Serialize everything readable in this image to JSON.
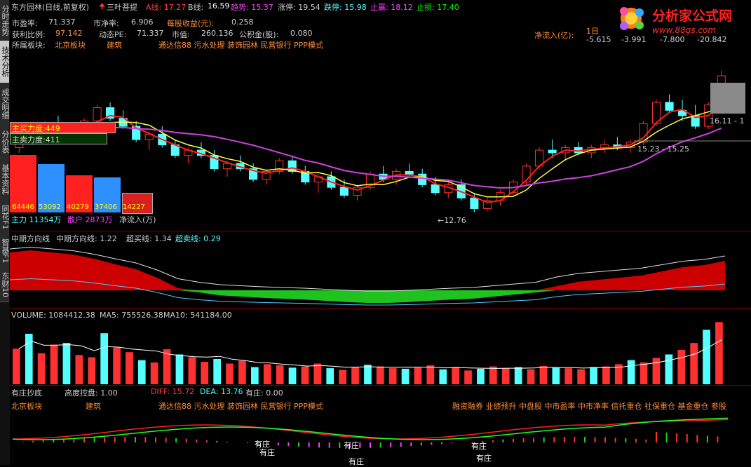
{
  "side_tabs": [
    {
      "label": "分时走势",
      "active": false
    },
    {
      "label": "技术分析",
      "active": true
    },
    {
      "label": "成交明细",
      "active": false
    },
    {
      "label": "分价表",
      "active": false
    },
    {
      "label": "基本资料",
      "active": false
    },
    {
      "label": "同花F1",
      "active": false
    },
    {
      "label": "智基F1",
      "active": false
    },
    {
      "label": "东财10",
      "active": false
    }
  ],
  "header": {
    "stock_title": "东方园林(日线,前复权)",
    "indicator_name": "三叶菩提",
    "a_line": "A线: 17.27",
    "b_line_label": "B线:",
    "b_line_value": "16.59",
    "trend": "趋势: 15.37",
    "limit_up": "涨停: 19.54",
    "limit_down": "跌停: 15.98",
    "take_profit": "止赢: 18.12",
    "stop_loss": "止损: 17.40"
  },
  "fundamentals": {
    "pe_label": "市盈率:",
    "pe_value": "71.337",
    "pb_label": "市净率:",
    "pb_value": "6.906",
    "eps_label": "每股收益(元):",
    "eps_value": "0.258",
    "profit_label": "获利比例:",
    "profit_value": "97.142",
    "dpe_label": "动态PE:",
    "dpe_value": "71.337",
    "mv_label": "市值:",
    "mv_value": "260.136",
    "reserve_label": "公积金(股):",
    "reserve_value": "0.080",
    "sector_label": "所属板块:",
    "sector_1": "北京板块",
    "sector_2": "建筑",
    "concepts": "通达信88 污水处理 装饰园林 民营银行 PPP模式"
  },
  "net_inflow": {
    "title": "净流入(亿):",
    "day_label": "1日",
    "values": [
      "-5.615",
      "-3.991",
      "-7.800",
      "-20.842"
    ]
  },
  "logo": {
    "text": "分析家公式网",
    "url": "www.88gs.com"
  },
  "force_panel": {
    "buy_label": "主买力度:449",
    "sell_label": "主卖力度:411",
    "bars": [
      "64446",
      "53092",
      "40279",
      "37406",
      "14227"
    ],
    "main_force": "主力 11354万",
    "retail": "散户 2873万",
    "net_label": "净流入(万)"
  },
  "price_labels": {
    "low_marker": "12.76",
    "range_label": "15.23 - 15.25",
    "right_label": "16.11 - 1"
  },
  "mid_panel": {
    "name": "中期方向线",
    "line_label": "中期方向线: 1.22",
    "overbuy_label": "超买线: 1.34",
    "oversell_label": "超卖线: 0.29"
  },
  "volume_panel": {
    "volume": "VOLUME: 1084412.38",
    "ma5": "MA5: 755526.38",
    "ma10": "MA10: 541184.00"
  },
  "bottom_panel": {
    "name": "有庄抄底",
    "control_label": "高度控盘: 1.00",
    "diff": "DIFF: 15.72",
    "dea": "DEA: 13.76",
    "has_dealer": "有庄: 0.00",
    "sector_1": "北京板块",
    "sector_2": "建筑",
    "concepts": "通达信88 污水处理 装饰园林 民营银行 PPP模式",
    "tags": "融资融券 业绩预升 中盘股 中市盈率 中市净率 信托重仓 社保重仓 基金重仓 参股",
    "markers": [
      "有庄",
      "有庄",
      "有庄",
      "有庄",
      "有庄",
      "有庄"
    ]
  },
  "chart_data": {
    "type": "candlestick",
    "candles": [
      [
        15.2,
        15.6,
        15.0,
        15.5
      ],
      [
        15.5,
        15.9,
        15.3,
        15.4
      ],
      [
        15.4,
        16.2,
        15.3,
        16.0
      ],
      [
        16.0,
        16.4,
        15.8,
        15.9
      ],
      [
        15.9,
        16.1,
        15.5,
        15.6
      ],
      [
        15.6,
        16.3,
        15.5,
        16.2
      ],
      [
        16.2,
        16.8,
        16.0,
        16.7
      ],
      [
        16.7,
        16.9,
        16.2,
        16.3
      ],
      [
        16.3,
        16.6,
        15.9,
        16.0
      ],
      [
        16.0,
        16.2,
        15.4,
        15.5
      ],
      [
        15.5,
        15.8,
        15.1,
        15.7
      ],
      [
        15.7,
        16.0,
        15.2,
        15.3
      ],
      [
        15.3,
        15.5,
        14.8,
        14.9
      ],
      [
        14.9,
        15.2,
        14.6,
        15.1
      ],
      [
        15.1,
        15.4,
        14.8,
        14.9
      ],
      [
        14.9,
        15.1,
        14.3,
        14.4
      ],
      [
        14.4,
        14.7,
        14.1,
        14.6
      ],
      [
        14.6,
        14.9,
        14.3,
        14.4
      ],
      [
        14.4,
        14.6,
        13.9,
        14.0
      ],
      [
        14.0,
        14.4,
        13.8,
        14.3
      ],
      [
        14.3,
        14.8,
        14.2,
        14.7
      ],
      [
        14.7,
        14.9,
        14.2,
        14.3
      ],
      [
        14.3,
        14.5,
        13.8,
        13.9
      ],
      [
        13.9,
        14.2,
        13.5,
        14.1
      ],
      [
        14.1,
        14.3,
        13.6,
        13.7
      ],
      [
        13.7,
        14.0,
        13.3,
        13.4
      ],
      [
        13.4,
        13.8,
        13.2,
        13.7
      ],
      [
        13.7,
        14.3,
        13.6,
        14.2
      ],
      [
        14.2,
        14.5,
        13.9,
        14.0
      ],
      [
        14.0,
        14.4,
        13.8,
        14.3
      ],
      [
        14.3,
        14.6,
        14.1,
        14.2
      ],
      [
        14.2,
        14.4,
        13.7,
        13.8
      ],
      [
        13.8,
        14.1,
        13.4,
        13.5
      ],
      [
        13.5,
        13.9,
        13.3,
        13.8
      ],
      [
        13.8,
        14.0,
        13.2,
        13.3
      ],
      [
        13.3,
        13.5,
        12.76,
        12.9
      ],
      [
        12.9,
        13.3,
        12.8,
        13.2
      ],
      [
        13.2,
        13.6,
        13.0,
        13.5
      ],
      [
        13.5,
        14.0,
        13.4,
        13.9
      ],
      [
        13.9,
        14.6,
        13.8,
        14.5
      ],
      [
        14.5,
        15.2,
        14.4,
        15.1
      ],
      [
        15.1,
        15.5,
        14.8,
        15.0
      ],
      [
        15.0,
        15.3,
        14.7,
        15.2
      ],
      [
        15.2,
        15.4,
        14.9,
        15.0
      ],
      [
        15.0,
        15.3,
        14.8,
        15.2
      ],
      [
        15.2,
        15.5,
        15.0,
        15.3
      ],
      [
        15.3,
        15.6,
        15.1,
        15.2
      ],
      [
        15.2,
        15.5,
        15.0,
        15.4
      ],
      [
        15.4,
        16.2,
        15.3,
        16.1
      ],
      [
        16.1,
        17.0,
        16.0,
        16.9
      ],
      [
        16.9,
        17.2,
        16.5,
        16.6
      ],
      [
        16.6,
        17.0,
        16.2,
        16.4
      ],
      [
        16.4,
        16.8,
        15.9,
        16.0
      ],
      [
        16.0,
        16.9,
        15.9,
        16.8
      ],
      [
        16.8,
        18.1,
        16.7,
        17.9
      ]
    ],
    "price_range": [
      12.2,
      18.8
    ],
    "mid_area": [
      0.9,
      0.95,
      0.9,
      0.85,
      0.75,
      0.62,
      0.5,
      0.3,
      0.05,
      -0.05,
      -0.12,
      -0.15,
      -0.18,
      -0.2,
      -0.22,
      -0.25,
      -0.28,
      -0.3,
      -0.3,
      -0.28,
      -0.25,
      -0.22,
      -0.2,
      -0.15,
      -0.1,
      -0.05,
      0.1,
      0.2,
      0.25,
      0.3,
      0.35,
      0.45,
      0.55,
      0.6,
      0.7
    ],
    "volume": [
      620,
      880,
      540,
      690,
      720,
      510,
      470,
      890,
      640,
      560,
      420,
      380,
      610,
      520,
      470,
      390,
      440,
      360,
      410,
      300,
      350,
      330,
      290,
      310,
      360,
      280,
      250,
      300,
      340,
      310,
      280,
      270,
      290,
      330,
      260,
      300,
      240,
      270,
      310,
      280,
      300,
      260,
      320,
      290,
      280,
      260,
      300,
      310,
      350,
      420,
      380,
      460,
      520,
      600,
      720,
      950,
      1084
    ],
    "volume_range": [
      0,
      1100
    ]
  }
}
